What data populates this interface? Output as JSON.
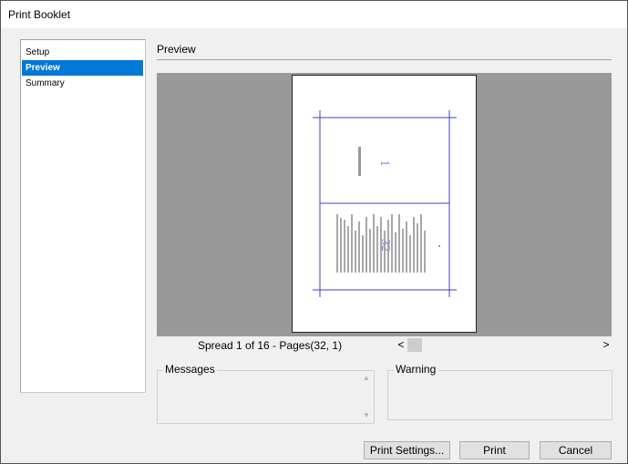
{
  "window": {
    "title": "Print Booklet"
  },
  "sidebar": {
    "items": [
      {
        "label": "Setup",
        "selected": false
      },
      {
        "label": "Preview",
        "selected": true
      },
      {
        "label": "Summary",
        "selected": false
      }
    ]
  },
  "preview": {
    "section_title": "Preview",
    "spread_label": "Spread 1 of 16 - Pages(32, 1)",
    "page_top_number": "1",
    "page_bottom_number": "32"
  },
  "scrollbar": {
    "left_arrow": "<",
    "right_arrow": ">"
  },
  "messages": {
    "label": "Messages",
    "up_arrow": "▲",
    "down_arrow": "▼"
  },
  "warning": {
    "label": "Warning"
  },
  "buttons": {
    "print_settings": "Print Settings...",
    "print": "Print",
    "cancel": "Cancel"
  },
  "colors": {
    "selection": "#0078d7",
    "preview_bg": "#999999",
    "guide_lines": "#4040c0"
  }
}
